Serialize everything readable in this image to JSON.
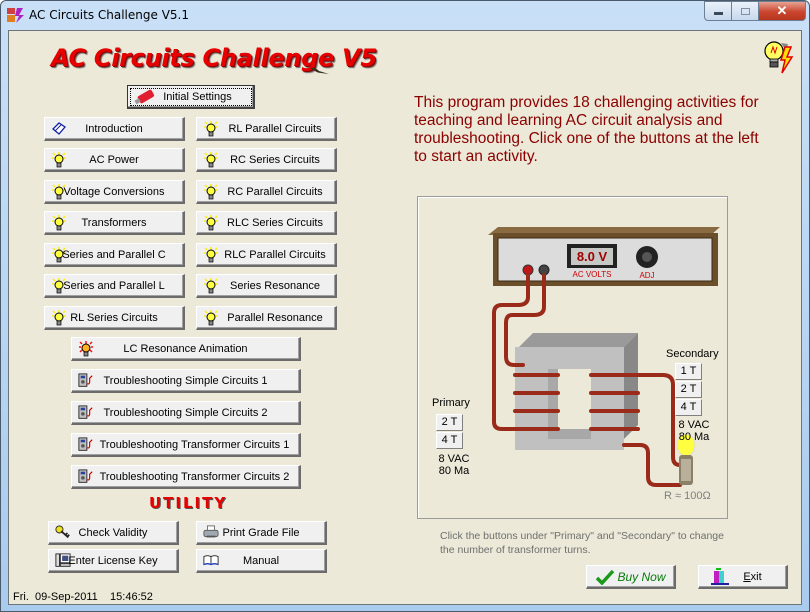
{
  "window": {
    "title": "AC Circuits Challenge V5.1",
    "caption_buttons": [
      "minimize",
      "maximize",
      "close"
    ]
  },
  "header": {
    "logo_text": "AC Circuits Challenge V5",
    "corner_icon": "lightbulb-lightning-icon"
  },
  "initial_settings": {
    "label": "Initial Settings",
    "icon": "usb-drive-icon"
  },
  "activities": {
    "left_column": [
      {
        "label": "Introduction",
        "icon": "book-icon"
      },
      {
        "label": "AC Power",
        "icon": "lightbulb-icon"
      },
      {
        "label": "Voltage Conversions",
        "icon": "lightbulb-icon"
      },
      {
        "label": "Transformers",
        "icon": "lightbulb-icon"
      },
      {
        "label": "Series and Parallel C",
        "icon": "lightbulb-icon"
      },
      {
        "label": "Series and Parallel L",
        "icon": "lightbulb-icon"
      },
      {
        "label": "RL Series Circuits",
        "icon": "lightbulb-icon"
      }
    ],
    "right_column": [
      {
        "label": "RL Parallel Circuits",
        "icon": "lightbulb-icon"
      },
      {
        "label": "RC Series Circuits",
        "icon": "lightbulb-icon"
      },
      {
        "label": "RC Parallel Circuits",
        "icon": "lightbulb-icon"
      },
      {
        "label": "RLC Series Circuits",
        "icon": "lightbulb-icon"
      },
      {
        "label": "RLC Parallel Circuits",
        "icon": "lightbulb-icon"
      },
      {
        "label": "Series Resonance",
        "icon": "lightbulb-icon"
      },
      {
        "label": "Parallel Resonance",
        "icon": "lightbulb-icon"
      }
    ],
    "wide": [
      {
        "label": "LC Resonance Animation",
        "icon": "red-lightbulb-icon"
      },
      {
        "label": "Troubleshooting Simple Circuits 1",
        "icon": "multimeter-icon"
      },
      {
        "label": "Troubleshooting Simple Circuits 2",
        "icon": "multimeter-icon"
      },
      {
        "label": "Troubleshooting Transformer Circuits 1",
        "icon": "multimeter-icon"
      },
      {
        "label": "Troubleshooting Transformer Circuits 2",
        "icon": "multimeter-icon"
      }
    ]
  },
  "utility": {
    "title": "UTILITY",
    "buttons": [
      {
        "label": "Check Validity",
        "icon": "key-icon"
      },
      {
        "label": "Print Grade File",
        "icon": "printer-icon"
      },
      {
        "label": "Enter License Key",
        "icon": "computer-icon"
      },
      {
        "label": "Manual",
        "icon": "open-book-icon"
      }
    ]
  },
  "status_bar": {
    "day": "Fri.",
    "date": "09-Sep-2011",
    "time": "15:46:52"
  },
  "description": "This program provides 18 challenging activities for teaching and learning AC circuit analysis and troubleshooting. Click one of the buttons at the left to start an activity.",
  "diagram": {
    "power_supply": {
      "display": "8.0 V",
      "display_label": "AC VOLTS",
      "knob_label": "ADJ"
    },
    "primary": {
      "title": "Primary",
      "turn_buttons": [
        "2 T",
        "4 T"
      ],
      "voltage": "8 VAC",
      "current": "80 Ma"
    },
    "secondary": {
      "title": "Secondary",
      "turn_buttons": [
        "1 T",
        "2 T",
        "4 T"
      ],
      "voltage": "8 VAC",
      "current": "80 Ma"
    },
    "resistance": "R ≈ 100Ω"
  },
  "hint": "Click the buttons under \"Primary\" and \"Secondary\" to change the number of transformer turns.",
  "footer": {
    "buy_now": {
      "label": "Buy Now",
      "icon": "checkmark-icon"
    },
    "exit": {
      "label_underlined": "E",
      "label_rest": "xit",
      "icon": "exit-door-icon"
    }
  },
  "colors": {
    "accent_red": "#e60000",
    "description_text": "#8b0000",
    "background": "#ece9d8",
    "buy_now_text": "#0a7a0a"
  }
}
